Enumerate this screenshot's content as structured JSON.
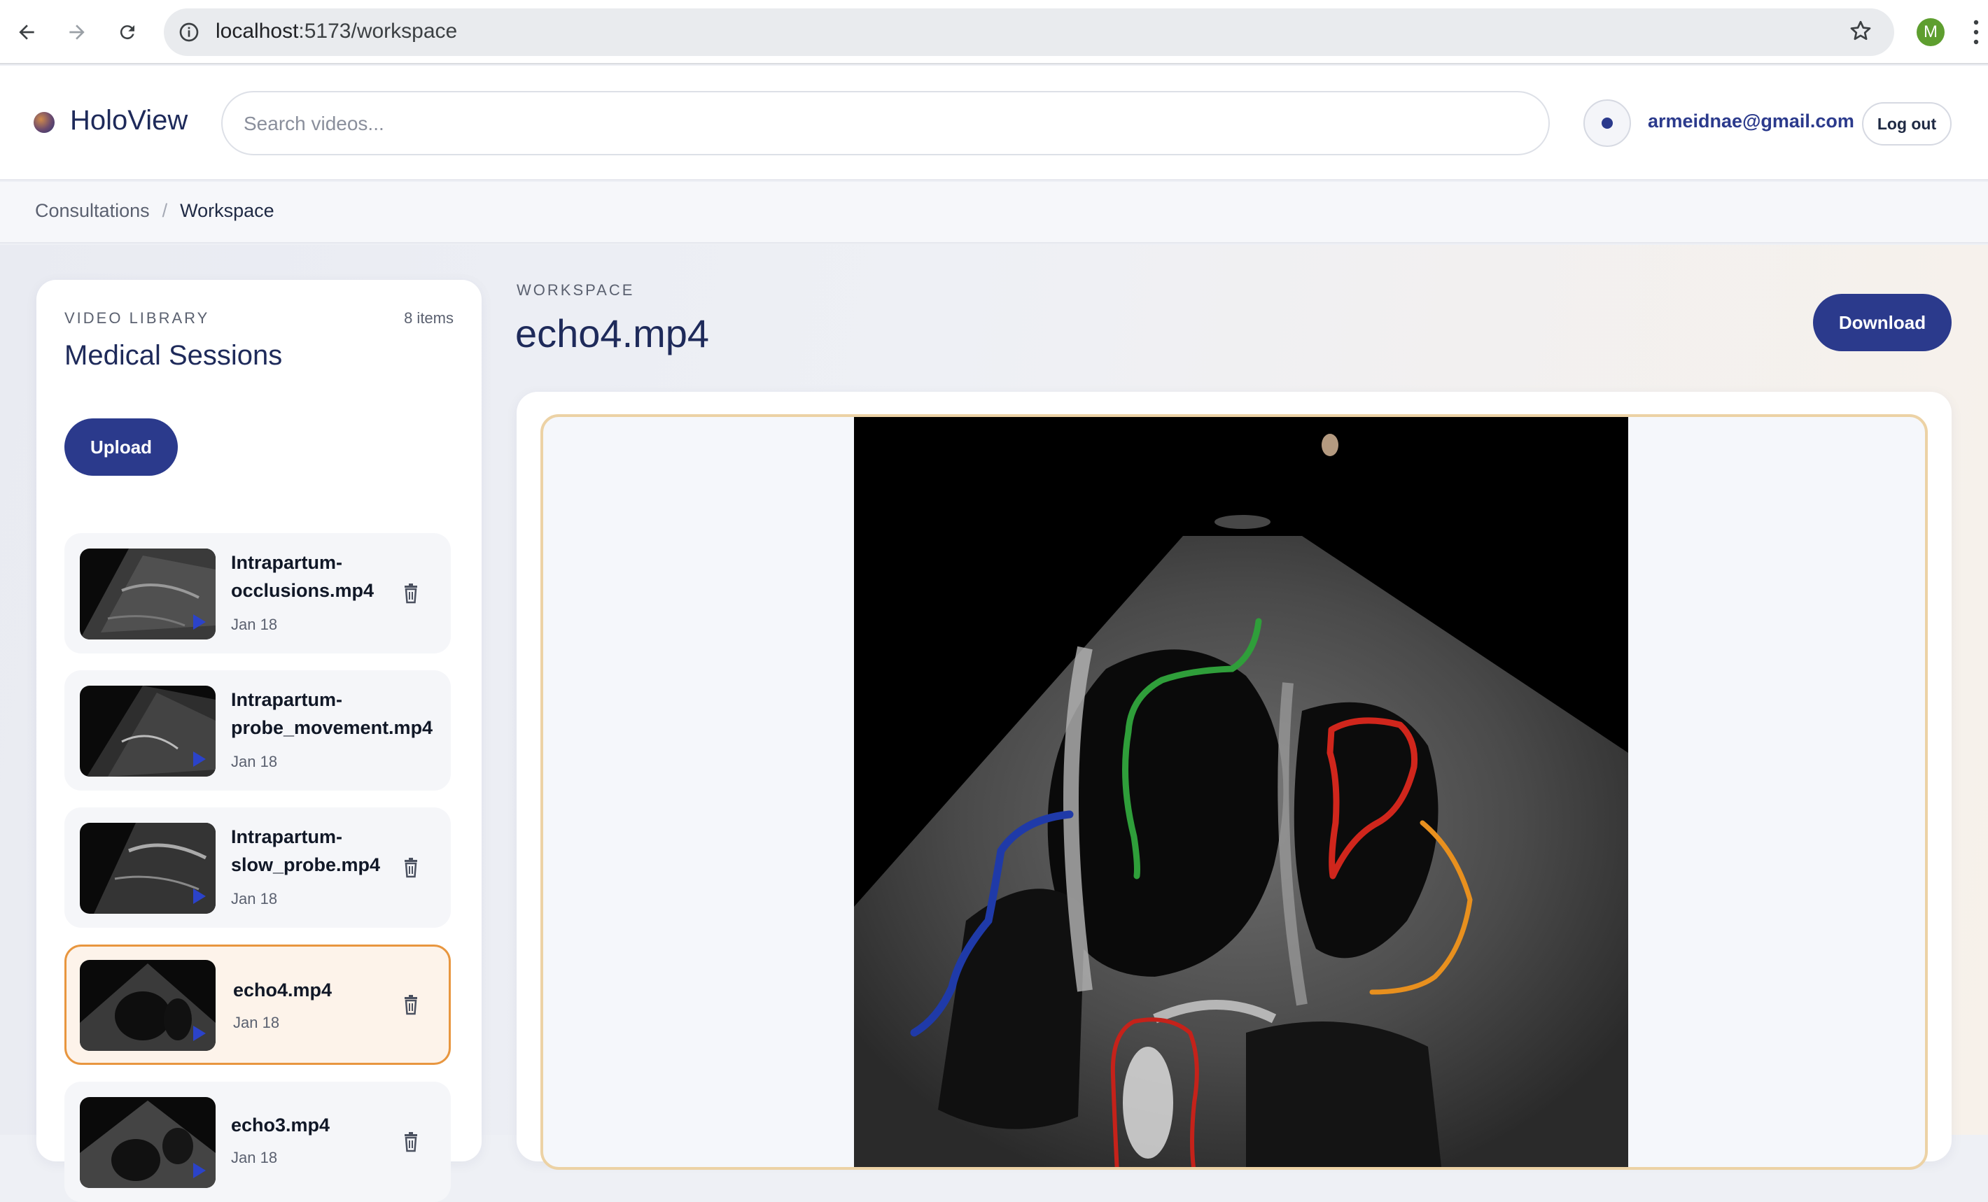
{
  "browser": {
    "url_host": "localhost",
    "url_rest": ":5173/workspace",
    "profile_initial": "M"
  },
  "header": {
    "app_name": "HoloView",
    "search_placeholder": "Search videos...",
    "user_email": "armeidnae@gmail.com",
    "logout_label": "Log out"
  },
  "breadcrumb": {
    "items": [
      "Consultations",
      "Workspace"
    ],
    "separator": "/"
  },
  "sidebar": {
    "kicker": "VIDEO LIBRARY",
    "count": "8 items",
    "title": "Medical Sessions",
    "upload_label": "Upload",
    "items": [
      {
        "name": "Intrapartum-\nocclusions.mp4",
        "date": "Jan 18",
        "active": false
      },
      {
        "name": "Intrapartum-\nprobe_movement.mp4",
        "date": "Jan 18",
        "active": false
      },
      {
        "name": "Intrapartum-\nslow_probe.mp4",
        "date": "Jan 18",
        "active": false
      },
      {
        "name": "echo4.mp4",
        "date": "Jan 18",
        "active": true
      },
      {
        "name": "echo3.mp4",
        "date": "Jan 18",
        "active": false
      }
    ]
  },
  "workspace": {
    "kicker": "WORKSPACE",
    "title": "echo4.mp4",
    "download_label": "Download",
    "annotation_colors": {
      "green": "#2f9e3a",
      "red": "#d0261c",
      "blue": "#1f3aa8",
      "orange": "#e8901e"
    }
  },
  "colors": {
    "primary": "#2b3a8c",
    "active_border": "#e8963f",
    "frame_border": "#ecd2a5"
  }
}
